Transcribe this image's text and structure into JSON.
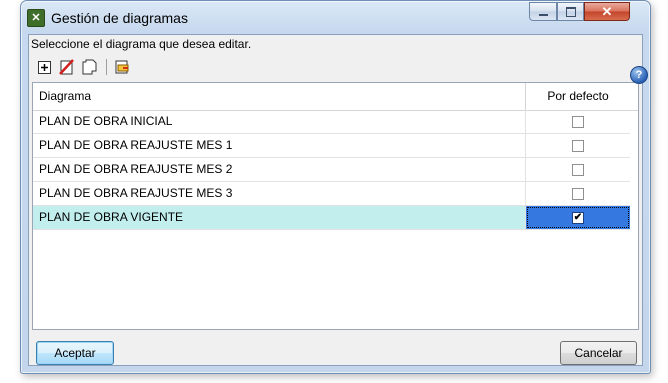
{
  "window": {
    "title": "Gestión de diagramas",
    "icon": "diagram-app-icon",
    "controls": [
      "minimize",
      "maximize",
      "close"
    ]
  },
  "instructions": "Seleccione el diagrama que desea editar.",
  "toolbar": {
    "buttons": [
      "add-icon",
      "delete-icon",
      "copy-icon",
      "export-icon"
    ]
  },
  "table": {
    "columns": [
      "Diagrama",
      "Por defecto"
    ],
    "rows": [
      {
        "name": "PLAN DE OBRA INICIAL",
        "default": false
      },
      {
        "name": "PLAN DE OBRA REAJUSTE MES 1",
        "default": false
      },
      {
        "name": "PLAN DE OBRA REAJUSTE MES 2",
        "default": false
      },
      {
        "name": "PLAN DE OBRA REAJUSTE MES 3",
        "default": false
      },
      {
        "name": "PLAN DE OBRA VIGENTE",
        "default": true
      }
    ],
    "selected_row": 4
  },
  "buttons": {
    "accept": "Aceptar",
    "cancel": "Cancelar"
  },
  "colors": {
    "selected_row": "#c2eeee",
    "selected_cell": "#3478e0",
    "title_bar": "#c7d9ee"
  }
}
